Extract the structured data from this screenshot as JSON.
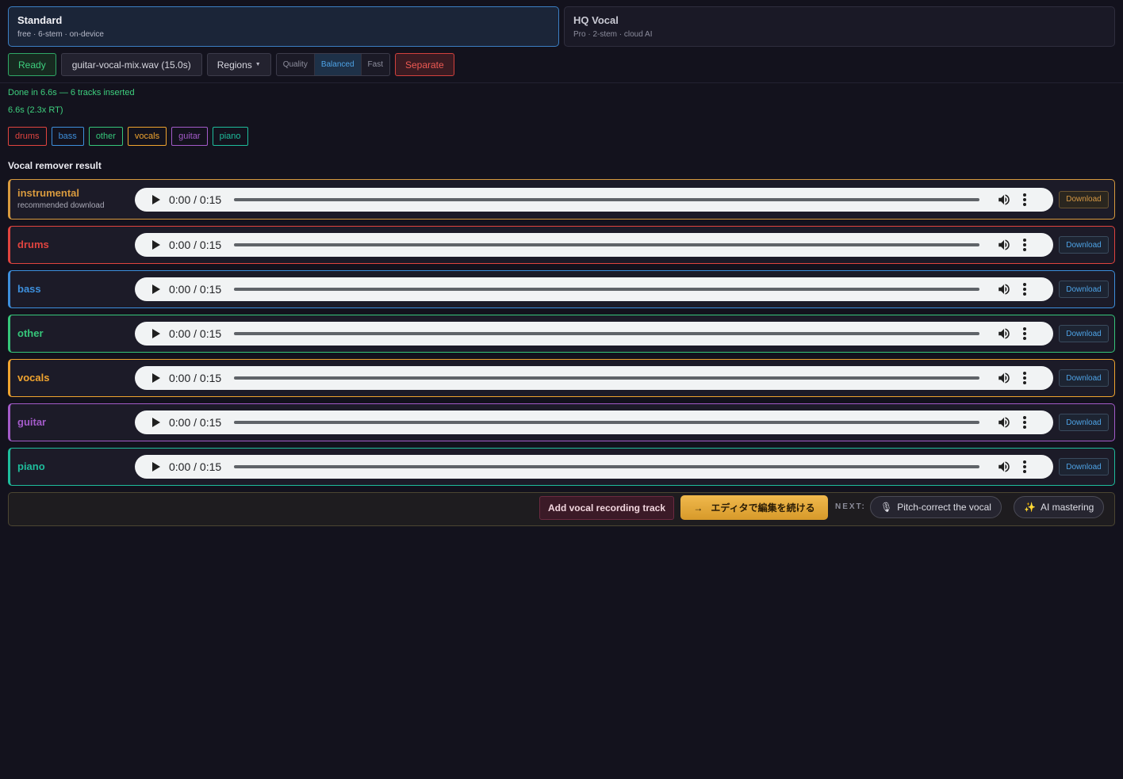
{
  "modes": [
    {
      "title": "Standard",
      "subtitle": "free · 6-stem · on-device"
    },
    {
      "title": "HQ Vocal",
      "subtitle": "Pro · 2-stem · cloud AI"
    }
  ],
  "toolbar": {
    "status": "Ready",
    "file": "guitar-vocal-mix.wav (15.0s)",
    "regions": "Regions",
    "quality_options": [
      "Quality",
      "Balanced",
      "Fast"
    ],
    "quality_selected": "Balanced",
    "separate": "Separate"
  },
  "status": {
    "line1": "Done in 6.6s — 6 tracks inserted",
    "line2": "6.6s (2.3x RT)"
  },
  "chips": [
    {
      "label": "drums",
      "color": "#e0443f"
    },
    {
      "label": "bass",
      "color": "#3d8fdc"
    },
    {
      "label": "other",
      "color": "#36c67a"
    },
    {
      "label": "vocals",
      "color": "#f0a42f"
    },
    {
      "label": "guitar",
      "color": "#a35bc9"
    },
    {
      "label": "piano",
      "color": "#1ebd9c"
    }
  ],
  "section_title": "Vocal remover result",
  "stems": [
    {
      "name": "instrumental",
      "sub": "recommended download",
      "color": "#d89a3e",
      "time": "0:00 / 0:15",
      "download": "Download"
    },
    {
      "name": "drums",
      "sub": "",
      "color": "#e0443f",
      "time": "0:00 / 0:15",
      "download": "Download"
    },
    {
      "name": "bass",
      "sub": "",
      "color": "#3d8fdc",
      "time": "0:00 / 0:15",
      "download": "Download"
    },
    {
      "name": "other",
      "sub": "",
      "color": "#36c67a",
      "time": "0:00 / 0:15",
      "download": "Download"
    },
    {
      "name": "vocals",
      "sub": "",
      "color": "#f0a42f",
      "time": "0:00 / 0:15",
      "download": "Download"
    },
    {
      "name": "guitar",
      "sub": "",
      "color": "#a35bc9",
      "time": "0:00 / 0:15",
      "download": "Download"
    },
    {
      "name": "piano",
      "sub": "",
      "color": "#1ebd9c",
      "time": "0:00 / 0:15",
      "download": "Download"
    }
  ],
  "actions": {
    "add_vocal": "Add vocal recording track",
    "editor": "エディタで編集を続ける",
    "editor_icon": "arrow-right-icon",
    "next_label": "NEXT:",
    "pitch": "Pitch-correct the vocal",
    "pitch_icon": "microphone-icon",
    "mastering": "AI mastering",
    "mastering_icon": "sparkles-icon"
  }
}
